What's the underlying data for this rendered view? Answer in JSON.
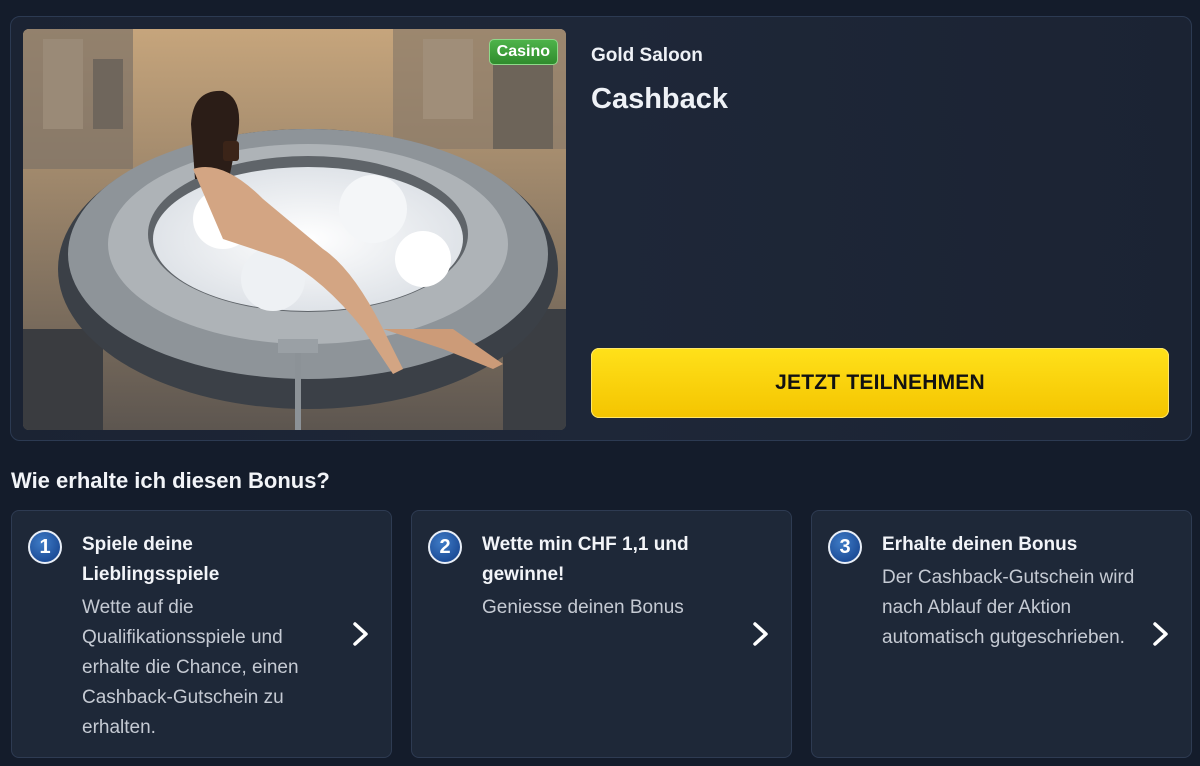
{
  "promo": {
    "badge": "Casino",
    "provider": "Gold Saloon",
    "title": "Cashback",
    "cta_label": "JETZT TEILNEHMEN",
    "image_icon": "promo-illustration"
  },
  "how_to": {
    "heading": "Wie erhalte ich diesen Bonus?",
    "steps": [
      {
        "number": "1",
        "title": "Spiele deine Lieblingsspiele",
        "description": "Wette auf die Qualifikationsspiele und erhalte die Chance, einen Cashback-Gutschein zu erhalten.",
        "arrow_icon": "chevron-right-icon"
      },
      {
        "number": "2",
        "title": "Wette min CHF 1,1 und gewinne!",
        "description": "Geniesse deinen Bonus",
        "arrow_icon": "chevron-right-icon"
      },
      {
        "number": "3",
        "title": "Erhalte deinen Bonus",
        "description": "Der Cashback-Gutschein wird nach Ablauf der Aktion automatisch gutgeschrieben.",
        "arrow_icon": "chevron-right-icon"
      }
    ]
  },
  "colors": {
    "background": "#141c2b",
    "card": "#1e2838",
    "cta": "#f4c400",
    "badge": "#3a9e37",
    "step_number": "#1e4f9a"
  }
}
